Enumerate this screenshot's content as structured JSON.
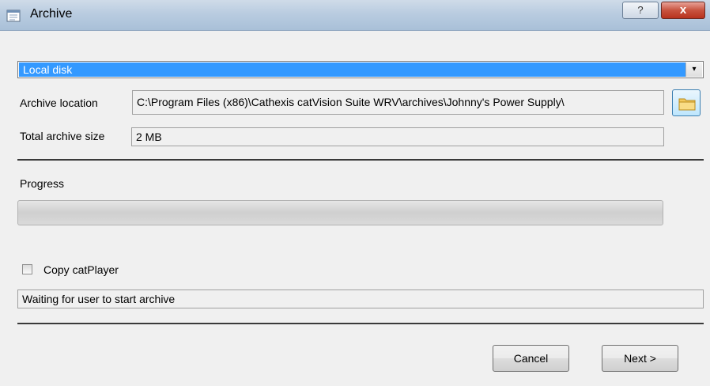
{
  "window": {
    "title": "Archive",
    "help_glyph": "?",
    "close_glyph": "x"
  },
  "destination": {
    "selected": "Local disk",
    "arrow_glyph": "▾"
  },
  "archive_location": {
    "label": "Archive location",
    "value": "C:\\Program Files (x86)\\Cathexis catVision Suite WRV\\archives\\Johnny's Power Supply\\"
  },
  "total_size": {
    "label": "Total archive size",
    "value": "2 MB"
  },
  "progress": {
    "label": "Progress",
    "fraction": 0
  },
  "copy_player": {
    "label": "Copy catPlayer",
    "checked": false
  },
  "status": {
    "text": "Waiting for user to start archive"
  },
  "buttons": {
    "cancel": "Cancel",
    "next": "Next >"
  },
  "icons": {
    "title": "archive-window-icon",
    "browse": "folder-icon"
  }
}
